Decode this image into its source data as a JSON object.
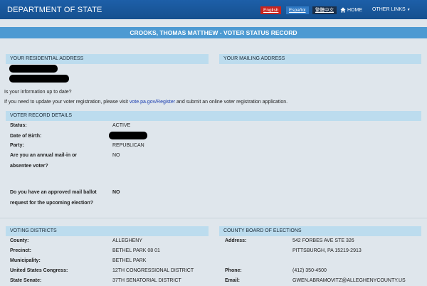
{
  "header": {
    "brand": "DEPARTMENT OF STATE",
    "languages": [
      "English",
      "Español",
      "繁體中文"
    ],
    "home": "HOME",
    "other_links": "OTHER LINKS"
  },
  "page_title": "CROOKS, THOMAS MATTHEW - VOTER STATUS RECORD",
  "residential": {
    "heading": "YOUR RESIDENTIAL ADDRESS"
  },
  "mailing": {
    "heading": "YOUR MAILING ADDRESS"
  },
  "update": {
    "question": "Is your information up to date?",
    "prefix": "If you need to update your voter registration, please visit ",
    "link": "vote.pa.gov/Register",
    "suffix": " and submit an online voter registration application."
  },
  "voter_record": {
    "heading": "VOTER RECORD DETAILS",
    "status_label": "Status:",
    "status_value": "ACTIVE",
    "dob_label": "Date of Birth:",
    "party_label": "Party:",
    "party_value": "REPUBLICAN",
    "annual_label_1": "Are you an annual mail-in or",
    "annual_label_2": "absentee voter?",
    "annual_value": "NO",
    "mail_ballot_label_1": "Do you have an approved mail ballot",
    "mail_ballot_label_2": "request for the upcoming election?",
    "mail_ballot_value": "NO"
  },
  "districts": {
    "heading": "VOTING DISTRICTS",
    "county_label": "County:",
    "county_value": "ALLEGHENY",
    "precinct_label": "Precinct:",
    "precinct_value": "BETHEL PARK 08 01",
    "municipality_label": "Municipality:",
    "municipality_value": "BETHEL PARK",
    "congress_label": "United States Congress:",
    "congress_value": "12TH CONGRESSIONAL DISTRICT",
    "senate_label": "State Senate:",
    "senate_value": "37TH SENATORIAL DISTRICT"
  },
  "board": {
    "heading": "COUNTY BOARD OF ELECTIONS",
    "address_label": "Address:",
    "address_line1": "542 FORBES AVE STE 326",
    "address_line2": "PITTSBURGH, PA 15219-2913",
    "phone_label": "Phone:",
    "phone_value": "(412) 350-4500",
    "email_label": "Email:",
    "email_value": "GWEN.ABRAMOVITZ@ALLEGHENYCOUNTY.US"
  },
  "colors": {
    "header": "#1a5aa0",
    "title_bar": "#4d9ad2",
    "section_head": "#bcdcee",
    "english_badge": "#c9241e",
    "link": "#1a3db0"
  },
  "icons": {
    "home": "home-icon",
    "dropdown": "caret-down-icon"
  }
}
